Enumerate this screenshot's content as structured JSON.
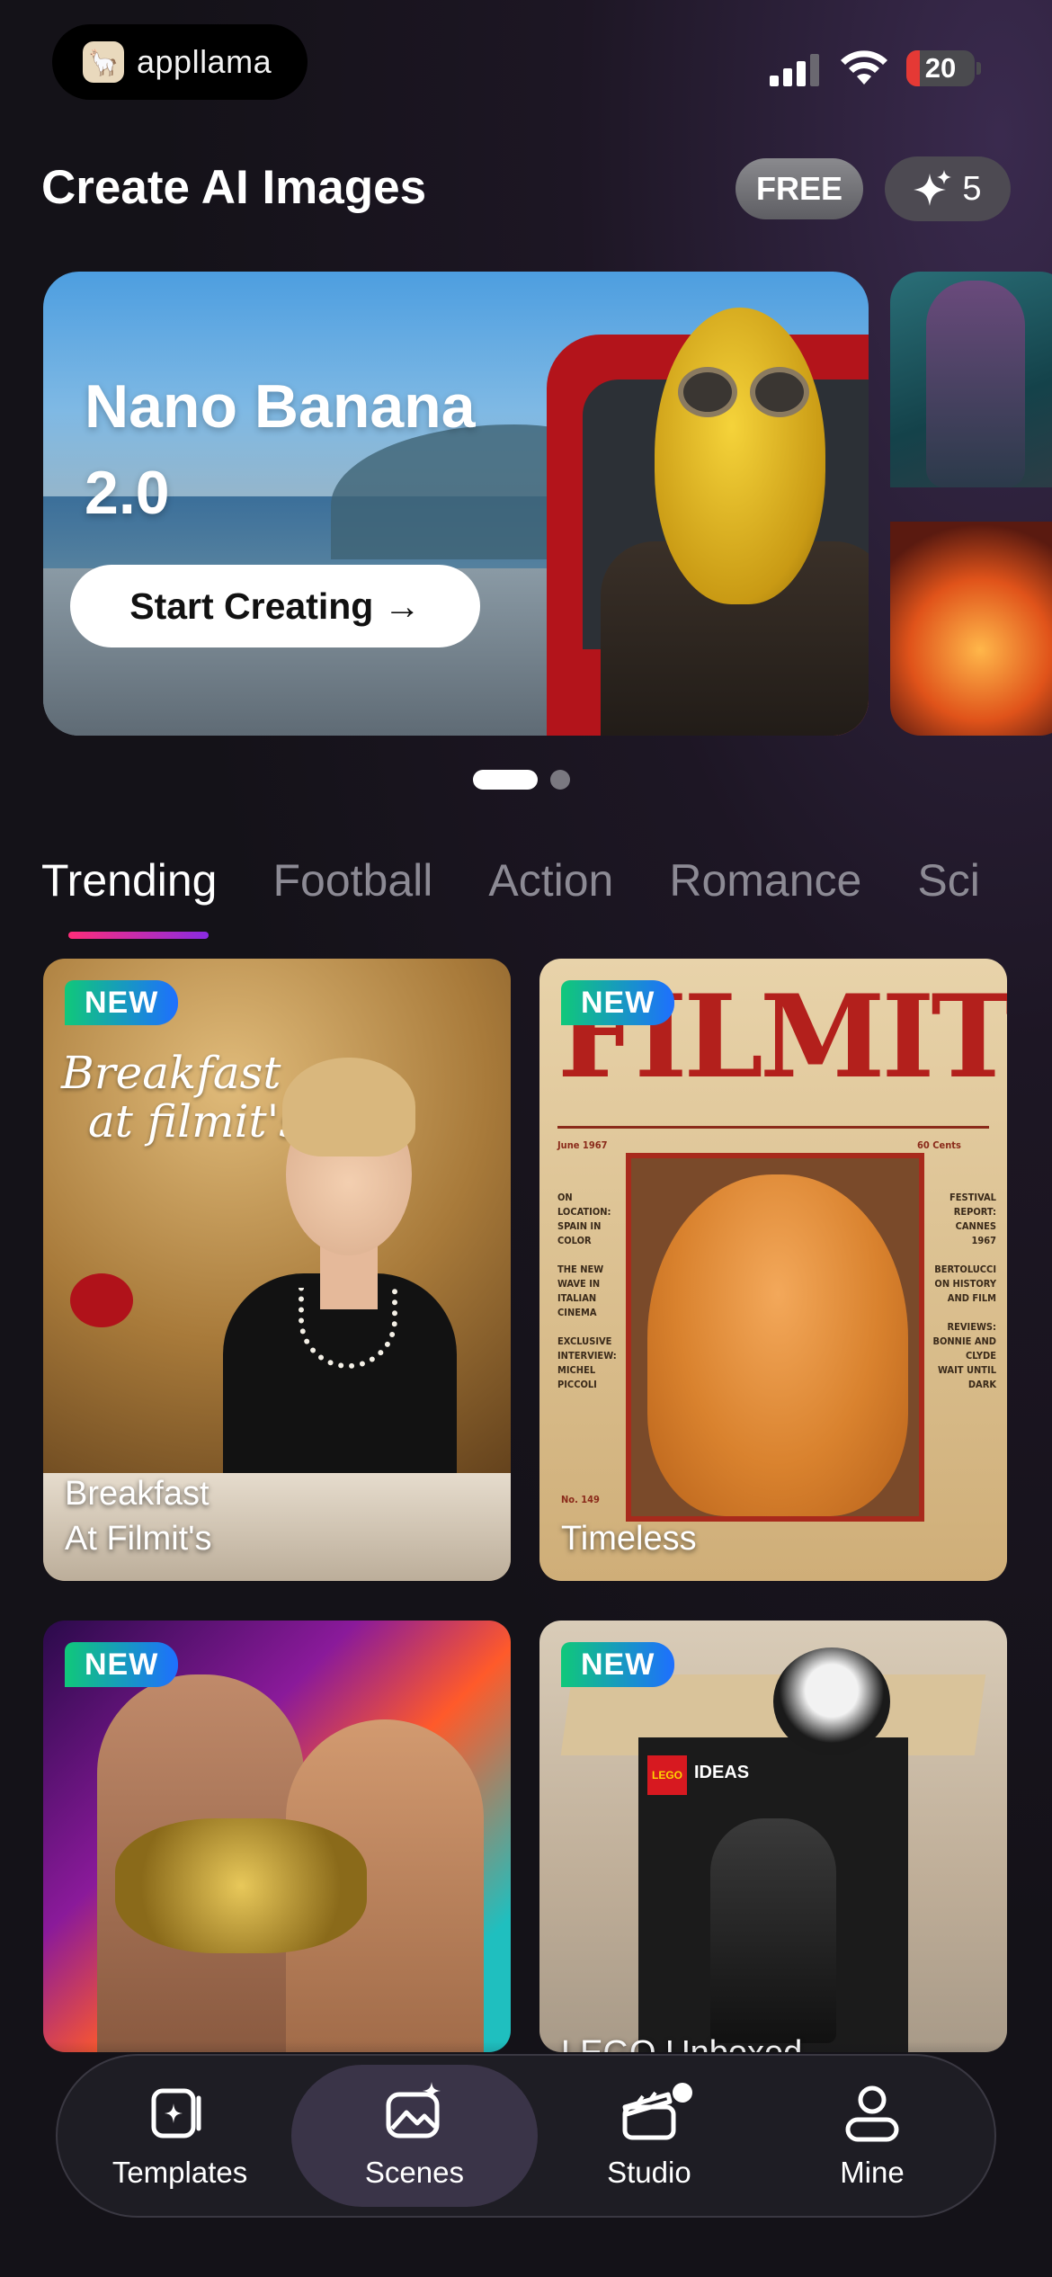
{
  "status_bar": {
    "app_name": "appllama",
    "battery": "20",
    "battery_level": 0.2
  },
  "header": {
    "title": "Create AI Images",
    "free_badge": "FREE",
    "credits": "5"
  },
  "hero": {
    "title_line1": "Nano Banana",
    "title_line2": "2.0",
    "cta_label": "Start Creating →",
    "page_count": 2,
    "active_page": 1
  },
  "tabs": [
    {
      "label": "Trending",
      "active": true
    },
    {
      "label": "Football"
    },
    {
      "label": "Action"
    },
    {
      "label": "Romance"
    },
    {
      "label": "Sci"
    }
  ],
  "cards": [
    {
      "badge": "NEW",
      "label": "Breakfast\nAt Filmit's",
      "art_text": {
        "script_line1": "Breakfast",
        "script_line2": "at filmit's"
      }
    },
    {
      "badge": "NEW",
      "label": "Timeless",
      "art_text": {
        "masthead": "FILMIT",
        "date": "June 1967",
        "price": "60 Cents",
        "left_col": "ON LOCATION: SPAIN IN COLOR\n\nTHE NEW WAVE IN ITALIAN CINEMA\n\nEXCLUSIVE INTERVIEW: MICHEL PICCOLI",
        "right_col": "FESTIVAL REPORT: CANNES 1967\n\nBERTOLUCCI ON HISTORY AND FILM\n\nREVIEWS: BONNIE AND CLYDE\nWAIT UNTIL DARK",
        "issue": "No. 149"
      }
    },
    {
      "badge": "NEW",
      "label": ""
    },
    {
      "badge": "NEW",
      "label": "LEGO Unboxed",
      "art_text": {
        "brand": "LEGO",
        "line": "IDEAS"
      }
    }
  ],
  "nav": [
    {
      "label": "Templates",
      "icon": "templates-icon"
    },
    {
      "label": "Scenes",
      "icon": "scenes-icon",
      "active": true
    },
    {
      "label": "Studio",
      "icon": "studio-icon",
      "has_badge": true
    },
    {
      "label": "Mine",
      "icon": "profile-icon"
    }
  ],
  "colors": {
    "tab_indicator_start": "#ff2d7a",
    "tab_indicator_end": "#8a2be2",
    "new_badge_start": "#10c87a",
    "new_badge_end": "#1e6fff",
    "nav_active": "#3a3448"
  }
}
